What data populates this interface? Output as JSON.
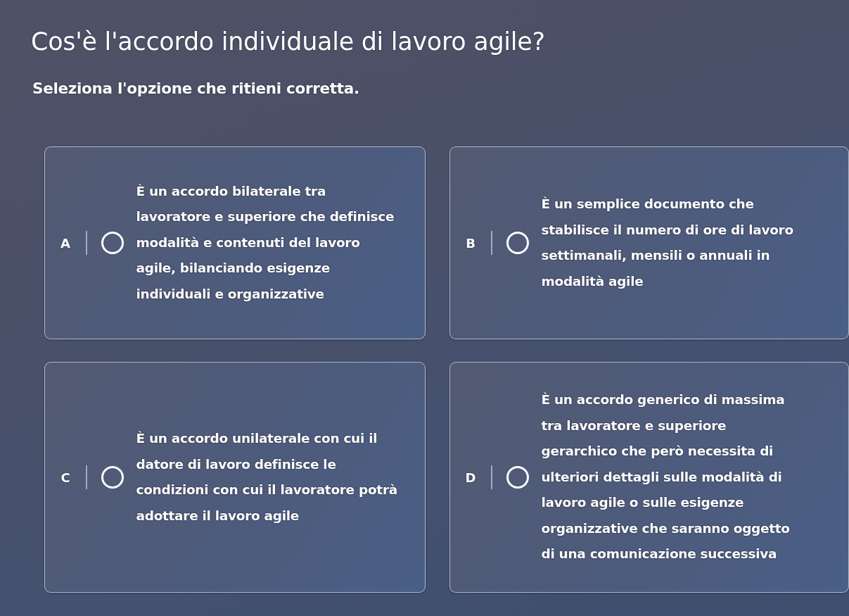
{
  "question": {
    "title": "Cos'è l'accordo individuale di lavoro agile?",
    "instruction": "Seleziona l'opzione che ritieni corretta."
  },
  "options": [
    {
      "letter": "A",
      "text": "È un accordo bilaterale tra lavoratore e superiore che definisce modalità e contenuti del lavoro agile, bilanciando esigenze individuali e organizzative",
      "selected": false
    },
    {
      "letter": "B",
      "text": "È un semplice documento che stabilisce il numero di ore di lavoro settimanali, mensili o annuali in modalità agile",
      "selected": false
    },
    {
      "letter": "C",
      "text": "È un accordo unilaterale con cui il datore di lavoro definisce le condizioni con cui il lavoratore potrà adottare il lavoro agile",
      "selected": false
    },
    {
      "letter": "D",
      "text": "È un accordo generico di massima tra lavoratore e superiore gerarchico che però necessita di ulteriori dettagli sulle modalità di lavoro agile o sulle esigenze organizzative che saranno oggetto di una comunicazione successiva",
      "selected": false
    }
  ]
}
